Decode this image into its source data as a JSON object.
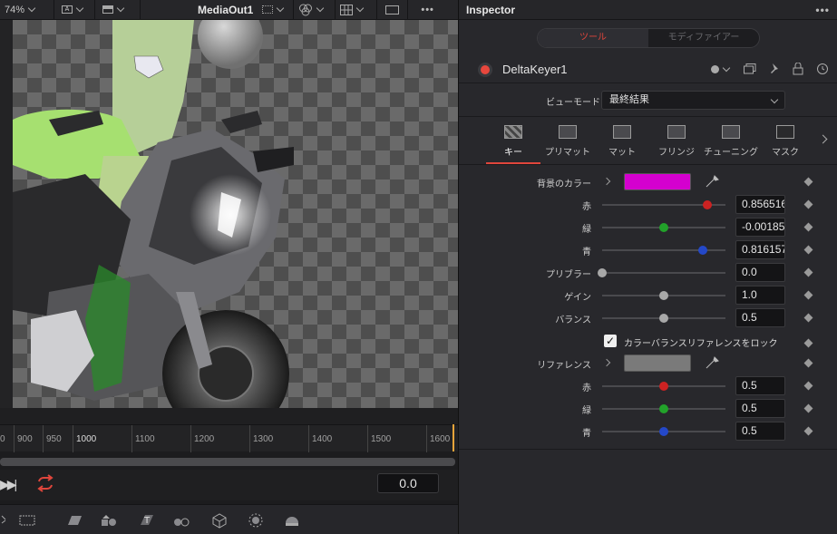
{
  "viewer": {
    "zoom": "74%",
    "view_name": "MediaOut1",
    "more": "•••"
  },
  "timeline": {
    "ticks": [
      "0",
      "900",
      "950",
      "1000",
      "1100",
      "1200",
      "1300",
      "1400",
      "1500",
      "1600"
    ],
    "current_time": "0.0"
  },
  "inspector": {
    "title": "Inspector",
    "more": "•••",
    "tabs_top": {
      "tools": "ツール",
      "modifiers": "モディファイアー"
    },
    "node_name": "DeltaKeyer1",
    "view_mode_label": "ビューモード",
    "view_mode_value": "最終結果",
    "tabs": [
      {
        "label": "キー",
        "icon": "key-icon"
      },
      {
        "label": "プリマット",
        "icon": "pre-matte-icon"
      },
      {
        "label": "マット",
        "icon": "matte-icon"
      },
      {
        "label": "フリンジ",
        "icon": "fringe-icon"
      },
      {
        "label": "チューニング",
        "icon": "tuning-icon"
      },
      {
        "label": "マスク",
        "icon": "mask-icon"
      }
    ],
    "background_color": {
      "label": "背景のカラー",
      "swatch": "#d400cf"
    },
    "red": {
      "label": "赤",
      "value": "0.856516",
      "color": "#cc2222",
      "level": 0.856516
    },
    "green": {
      "label": "緑",
      "value": "-0.001853",
      "color": "#22a22a",
      "level": 0.5
    },
    "blue": {
      "label": "青",
      "value": "0.816157",
      "color": "#2448c8",
      "level": 0.816157
    },
    "preblur": {
      "label": "プリブラー",
      "value": "0.0",
      "level": 0.0
    },
    "gain": {
      "label": "ゲイン",
      "value": "1.0",
      "level": 0.5
    },
    "balance": {
      "label": "バランス",
      "value": "0.5",
      "level": 0.5
    },
    "lock_checkbox": {
      "label": "カラーバランスリファレンスをロック",
      "checked": "✓"
    },
    "reference": {
      "label": "リファレンス",
      "swatch": "#7a7a7a"
    },
    "ref_red": {
      "label": "赤",
      "value": "0.5",
      "color": "#cc2222",
      "level": 0.5
    },
    "ref_green": {
      "label": "緑",
      "value": "0.5",
      "color": "#22a22a",
      "level": 0.5
    },
    "ref_blue": {
      "label": "青",
      "value": "0.5",
      "color": "#2448c8",
      "level": 0.5
    }
  }
}
